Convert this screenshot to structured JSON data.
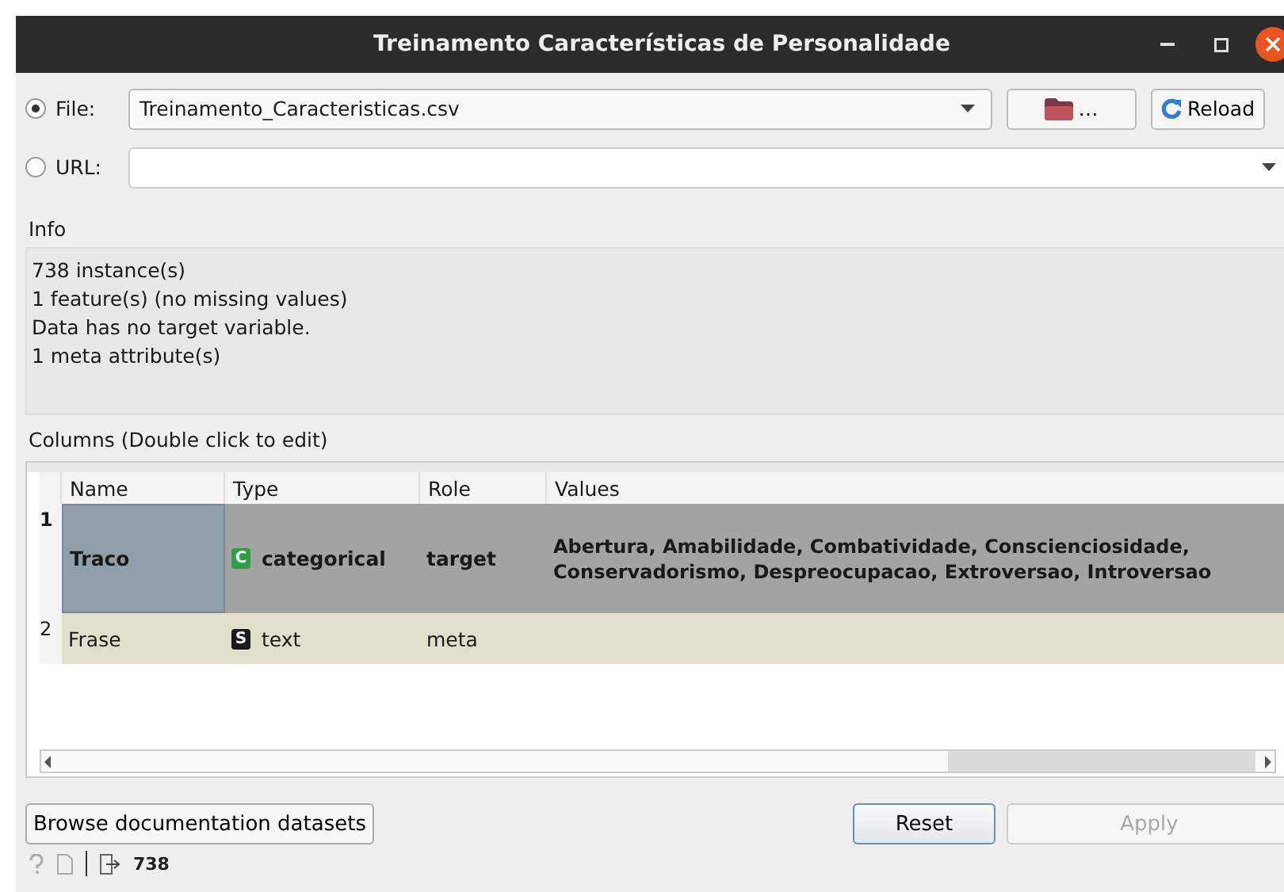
{
  "window": {
    "title": "Treinamento Características de Personalidade"
  },
  "source": [
    {
      "label": "File:",
      "selected": true,
      "value": "Treinamento_Caracteristicas.csv",
      "kind": "file"
    },
    {
      "label": "URL:",
      "selected": false,
      "kind": "url"
    }
  ],
  "browse_button": "…",
  "reload_button": "Reload",
  "info": {
    "title": "Info",
    "lines": [
      "738 instance(s)",
      "1 feature(s) (no missing values)",
      "Data has no target variable.",
      "1 meta attribute(s)"
    ]
  },
  "columns": {
    "title": "Columns (Double click to edit)",
    "headers": [
      "Name",
      "Type",
      "Role",
      "Values"
    ],
    "rows": [
      {
        "index": "1",
        "name": "Traco",
        "type_badge": "C",
        "type": "categorical",
        "role": "target",
        "values": "Abertura, Amabilidade, Combatividade, Conscienciosidade, Conservadorismo, Despreocupacao, Extroversao, Introversao",
        "selected": true,
        "kind": "discrete"
      },
      {
        "index": "2",
        "name": "Frase",
        "type_badge": "S",
        "type": "text",
        "role": "meta",
        "selected": false,
        "kind": "string"
      }
    ]
  },
  "buttons": [
    {
      "label": "Browse documentation datasets",
      "disabled": false
    },
    {
      "label": "Reset",
      "disabled": false
    },
    {
      "label": "Apply",
      "disabled": true
    }
  ],
  "status_bar": {
    "output_count": "738"
  }
}
